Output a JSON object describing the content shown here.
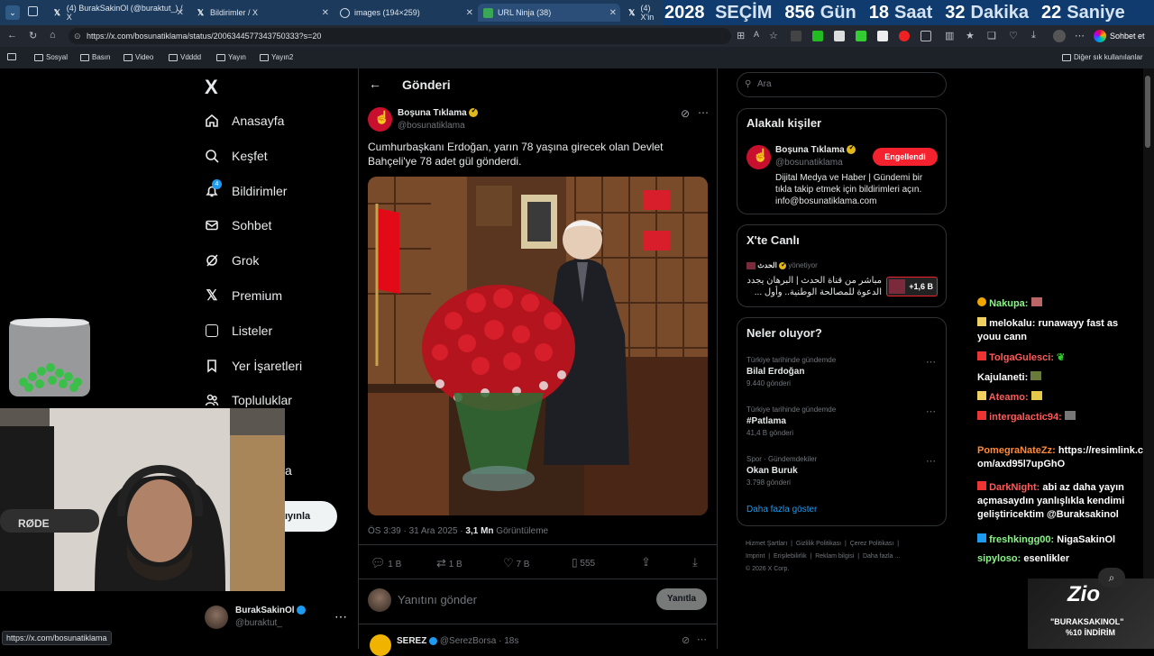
{
  "browser": {
    "tabs": [
      {
        "label": "(4) BurakSakinOl (@buraktut_) / X"
      },
      {
        "label": "Bildirimler / X"
      },
      {
        "label": "images (194×259)"
      },
      {
        "label": "URL Ninja (38)"
      },
      {
        "label": "(4) X'in"
      }
    ],
    "url": "https://x.com/bosunatiklama/status/2006344577343750333?s=20",
    "grok_label": "Sohbet et",
    "bookmarks": [
      "Sosyal",
      "Basın",
      "Video",
      "Vdddd",
      "Yayın",
      "Yayın2"
    ],
    "other_bookmarks": "Diğer sık kullanılanlar",
    "status_url": "https://x.com/bosunatiklama"
  },
  "countdown": {
    "year": "2028",
    "year_label": "SEÇİM",
    "days": "856",
    "days_label": "Gün",
    "hours": "18",
    "hours_label": "Saat",
    "minutes": "32",
    "minutes_label": "Dakika",
    "seconds": "22",
    "seconds_label": "Saniye"
  },
  "sidebar": {
    "logo": "X",
    "items": [
      {
        "label": "Anasayfa"
      },
      {
        "label": "Keşfet"
      },
      {
        "label": "Bildirimler",
        "badge": "4"
      },
      {
        "label": "Sohbet"
      },
      {
        "label": "Grok"
      },
      {
        "label": "Premium"
      },
      {
        "label": "Listeler"
      },
      {
        "label": "Yer İşaretleri"
      },
      {
        "label": "Topluluklar"
      }
    ],
    "partial_label": "a",
    "post_button": "ıyınla",
    "account": {
      "name": "BurakSakinOl",
      "handle": "@buraktut_"
    }
  },
  "post": {
    "header": "Gönderi",
    "author": "Boşuna Tıklama",
    "handle": "@bosunatiklama",
    "text": "Cumhurbaşkanı Erdoğan, yarın 78 yaşına girecek olan Devlet Bahçeli'ye 78 adet gül gönderdi.",
    "time": "ÖS 3:39 · 31 Ara 2025 · ",
    "views_count": "3,1 Mn",
    "views_label": " Görüntüleme",
    "replies": "1 B",
    "reposts": "1 B",
    "likes": "7 B",
    "bookmarks": "555",
    "reply_placeholder": "Yanıtını gönder",
    "reply_button": "Yanıtla",
    "next_author": "SEREZ",
    "next_handle": "@SerezBorsa · 18s"
  },
  "right": {
    "search_placeholder": "Ara",
    "related_title": "Alakalı kişiler",
    "related": {
      "name": "Boşuna Tıklama",
      "handle": "@bosunatiklama",
      "button": "Engellendi",
      "bio": "Dijital Medya ve Haber | Gündemi bir tıkla takip etmek için bildirimleri açın. info@bosunatiklama.com"
    },
    "live_title": "X'te Canlı",
    "live": {
      "host": "الحدث",
      "status": "yönetiyor",
      "text": "مباشر من قناة الحدث | البرهان يجدد الدعوة للمصالحة الوطنية.. وأول ...",
      "count": "+1,6 B"
    },
    "trends_title": "Neler oluyor?",
    "trends": [
      {
        "context": "Türkiye tarihinde gündemde",
        "name": "Bilal Erdoğan",
        "count": "9.440 gönderi"
      },
      {
        "context": "Türkiye tarihinde gündemde",
        "name": "#Patlama",
        "count": "41,4 B gönderi"
      },
      {
        "context": "Spor · Gündemdekiler",
        "name": "Okan Buruk",
        "count": "3.798 gönderi"
      }
    ],
    "show_more": "Daha fazla göster",
    "footer": [
      "Hizmet Şartları",
      "Gizlilik Politikası",
      "Çerez Politikası",
      "Imprint",
      "Erişilebilirlik",
      "Reklam bilgisi",
      "Daha fazla ...",
      "© 2026 X Corp."
    ]
  },
  "chat": [
    {
      "user": "Nakupa:",
      "msg": ""
    },
    {
      "user": "melokalu:",
      "msg": "runawayy fast as youu cann"
    },
    {
      "user": "TolgaGulesci:",
      "msg": ""
    },
    {
      "user": "Kajulaneti:",
      "msg": ""
    },
    {
      "user": "Ateamo:",
      "msg": ""
    },
    {
      "user": "intergalactic94:",
      "msg": ""
    },
    {
      "user": "PomegraNateZz:",
      "msg": "https://resimlink.com/axd95l7upGhO"
    },
    {
      "user": "DarkNight:",
      "msg": "abi az daha yayın açmasaydın yanlışlıkla kendimi geliştiricektim @Buraksakinol"
    },
    {
      "user": "freshkingg00:",
      "msg": "NigaSakinOl"
    },
    {
      "user": "sipyloso:",
      "msg": "esenlikler"
    }
  ],
  "promo": {
    "brand": "Zio",
    "line1": "\"BURAKSAKINOL\"",
    "line2": "%10 İNDİRİM"
  },
  "colors": {
    "blocked": "#f4212e",
    "link": "#1d9bf0",
    "tab_bg": "#1b3a5c"
  }
}
